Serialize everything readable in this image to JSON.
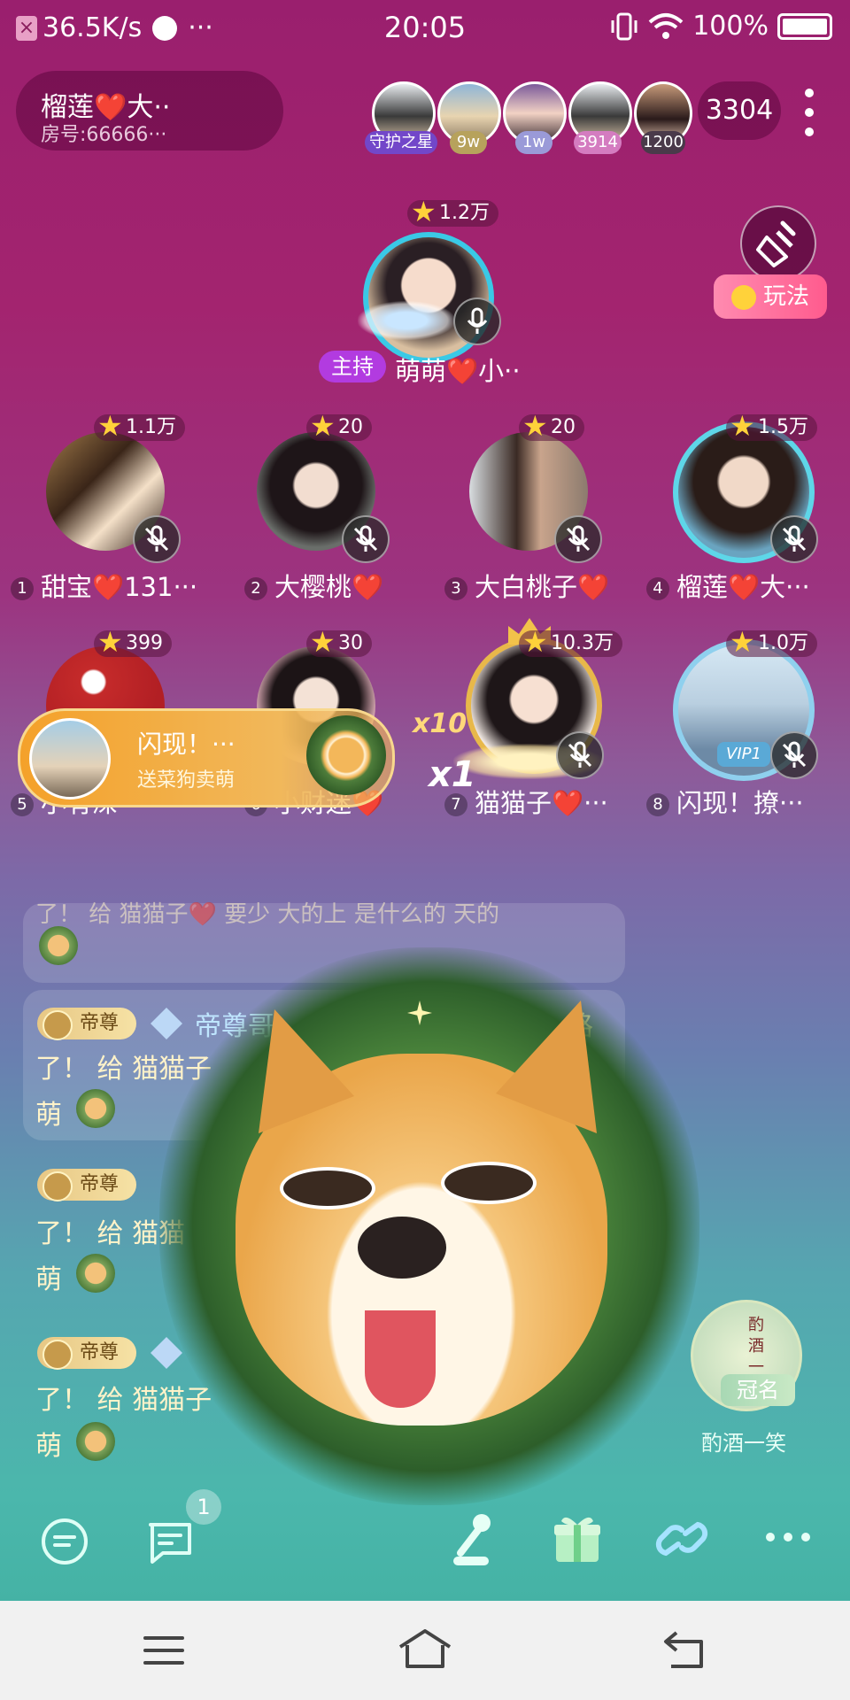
{
  "status": {
    "net": "36.5K/s",
    "time": "20:05",
    "battery": "100%"
  },
  "room": {
    "name": "榴莲❤️大··",
    "id": "房号:66666···"
  },
  "top_users": [
    {
      "badge": "守护之星"
    },
    {
      "badge": "9w"
    },
    {
      "badge": "1w"
    },
    {
      "badge": "3914"
    },
    {
      "badge": "1200"
    }
  ],
  "online_count": "3304",
  "play_label": "玩法",
  "host": {
    "tag": "主持",
    "name": "萌萌❤️小··",
    "score": "1.2万"
  },
  "seats": [
    {
      "num": "1",
      "name": "甜宝❤️131···",
      "score": "1.1万"
    },
    {
      "num": "2",
      "name": "大樱桃❤️",
      "score": "20"
    },
    {
      "num": "3",
      "name": "大白桃子❤️",
      "score": "20"
    },
    {
      "num": "4",
      "name": "榴莲❤️大···",
      "score": "1.5万"
    },
    {
      "num": "5",
      "name": "小有深",
      "score": "399"
    },
    {
      "num": "6",
      "name": "小财迷❤️",
      "score": "30"
    },
    {
      "num": "7",
      "name": "猫猫子❤️···",
      "score": "10.3万"
    },
    {
      "num": "8",
      "name": "闪现！撩···",
      "score": "1.0万"
    }
  ],
  "flash": {
    "title": "闪现！···",
    "subtitle": "送菜狗卖萌",
    "multiplier": "x10",
    "combo": "x1"
  },
  "chat": [
    {
      "badge": "帝尊",
      "name": "帝尊哥",
      "line1": "了！  给 猫猫子",
      "line2": "萌"
    },
    {
      "badge": "帝尊",
      "line1": "了！  给 猫猫",
      "line2": "萌"
    },
    {
      "badge": "帝尊",
      "line1": "了！  给 猫猫子",
      "line2": "萌"
    }
  ],
  "chat_top_fragment": "了！  给 猫猫子❤️ 要少 大的上 是什么的 天的",
  "chat_right_fragment": "路",
  "crown": {
    "label": "冠名",
    "name": "酌酒一笑",
    "seal": "酌 酒 一 笑"
  },
  "unread_count": "1",
  "colors": {
    "accent": "#ff5b8e",
    "host_tag": "#b23be0",
    "flash": "#f4a12a"
  }
}
